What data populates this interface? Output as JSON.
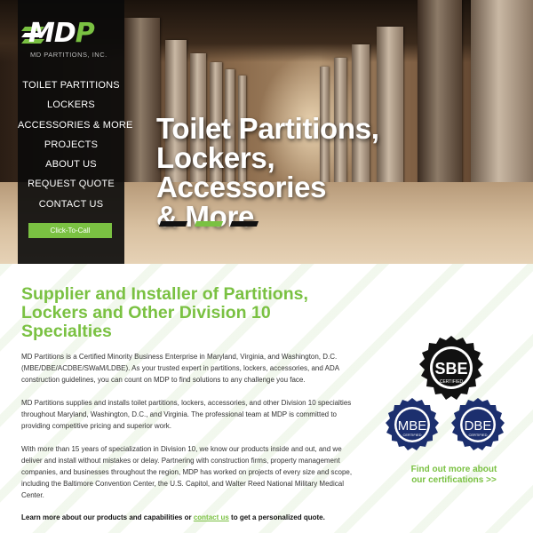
{
  "brand": {
    "logo_text": "MDP",
    "logo_subtitle": "MD PARTITIONS, INC."
  },
  "nav": {
    "items": [
      {
        "label": "TOILET PARTITIONS"
      },
      {
        "label": "LOCKERS"
      },
      {
        "label": "ACCESSORIES & MORE"
      },
      {
        "label": "PROJECTS"
      },
      {
        "label": "ABOUT US"
      },
      {
        "label": "REQUEST QUOTE"
      },
      {
        "label": "CONTACT US"
      }
    ],
    "call_button": "Click-To-Call"
  },
  "hero": {
    "title_line1": "Toilet Partitions,",
    "title_line2": "Lockers, Accessories",
    "title_line3": "& More",
    "slide_count": 3,
    "active_slide": 2
  },
  "colors": {
    "accent": "#7ac142",
    "sidebar_bg": "#0a0a0a",
    "text": "#333333",
    "badge_navy": "#1c2f6e",
    "badge_black": "#111111"
  },
  "main": {
    "headline_line1": "Supplier and Installer of Partitions,",
    "headline_line2": "Lockers and Other Division 10",
    "headline_line3": "Specialties",
    "para1_line1": "MD Partitions is a Certified Minority Business Enterprise in Maryland, Virginia, and Washington, D.C.",
    "para1_line2": "(MBE/DBE/ACDBE/SWaM/LDBE). As your trusted expert in partitions, lockers, accessories, and ADA",
    "para1_line3": "construction guidelines, you can count on MDP to find solutions to any challenge you face.",
    "para2_line1": "MD Partitions supplies and installs toilet partitions, lockers, accessories, and other Division 10 specialties",
    "para2_line2": "throughout Maryland, Washington, D.C., and Virginia. The professional team at MDP is committed to",
    "para2_line3": "providing competitive pricing and superior work.",
    "para3_line1": "With more than 15 years of specialization in Division 10, we know our products inside and out, and we",
    "para3_line2": "deliver and install without mistakes or delay. Partnering with construction firms, property management",
    "para3_line3": "companies, and businesses throughout the region, MDP has worked on projects of every size and scope,",
    "para3_line4": "including the Baltimore Convention Center, the U.S. Capitol, and Walter Reed National Military Medical",
    "para3_line5": "Center.",
    "cta_before": "Learn more about our products and capabilities or ",
    "cta_link": "contact us",
    "cta_after": " to get a personalized quote."
  },
  "certifications": {
    "badges": [
      {
        "abbr": "SBE",
        "label": "CERTIFIED"
      },
      {
        "abbr": "MBE",
        "label": "CERTIFIED",
        "ring_text": "MINORITY BUSINESS ENTERPRISE"
      },
      {
        "abbr": "DBE",
        "label": "CERTIFIED",
        "ring_text": "DISADVANTAGED BUSINESS ENTERPRISE"
      }
    ],
    "link_line1": "Find out more about",
    "link_line2": "our certifications >>"
  }
}
